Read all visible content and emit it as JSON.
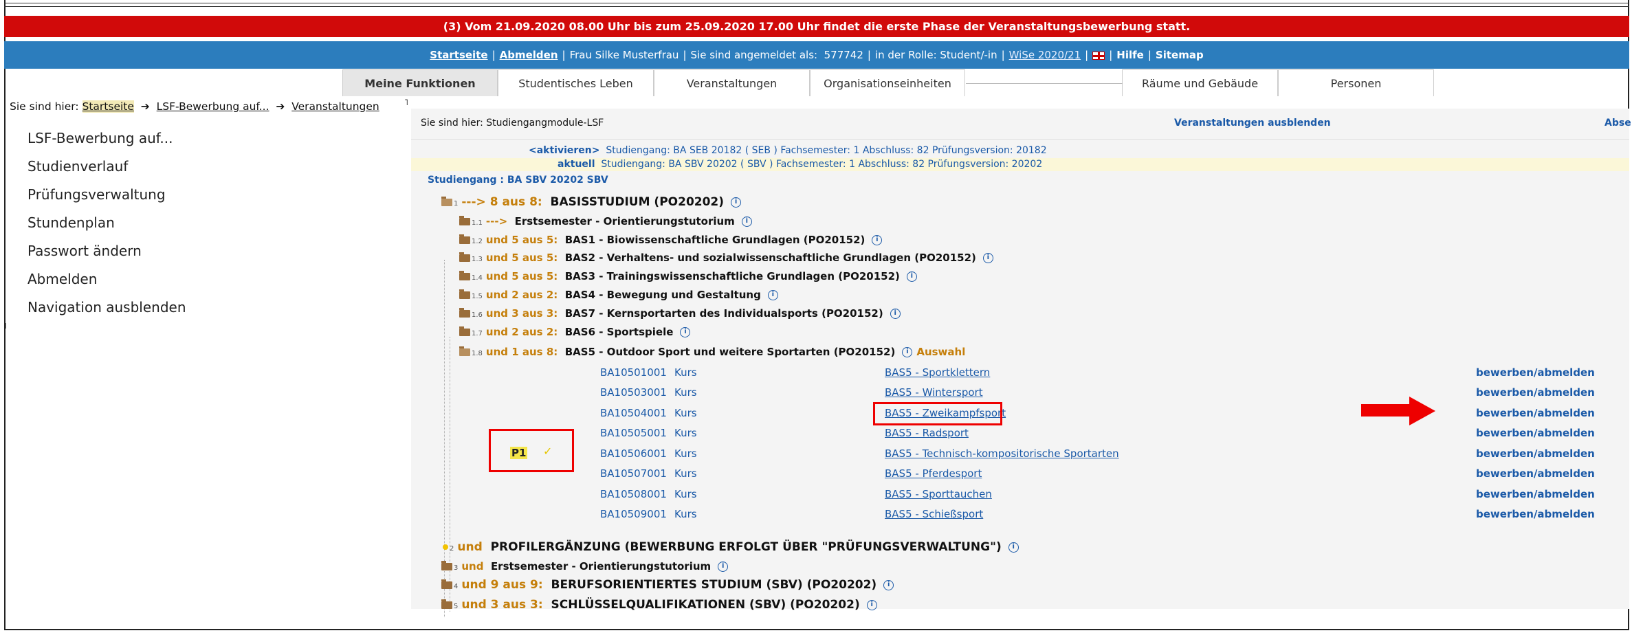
{
  "banner": "(3) Vom 21.09.2020 08.00 Uhr bis zum 25.09.2020 17.00 Uhr findet die erste Phase der Veranstaltungsbewerbung statt.",
  "toolbar": {
    "startseite": "Startseite",
    "abmelden": "Abmelden",
    "user": "Frau Silke Musterfrau",
    "logged_in_as": "Sie sind angemeldet als:",
    "user_id": "577742",
    "role": "in der Rolle: Student/-in",
    "semester": "WiSe 2020/21",
    "hilfe": "Hilfe",
    "sitemap": "Sitemap"
  },
  "tabs": [
    "Meine Funktionen",
    "Studentisches Leben",
    "Veranstaltungen",
    "Organisationseinheiten",
    "Räume und Gebäude",
    "Personen"
  ],
  "breadcrumb": {
    "prefix": "Sie sind hier:",
    "items": [
      "Startseite",
      "LSF-Bewerbung auf...",
      "Veranstaltungen"
    ]
  },
  "leftnav": [
    "LSF-Bewerbung auf...",
    "Studienverlauf",
    "Prüfungsverwaltung",
    "Stundenplan",
    "Passwort ändern",
    "Abmelden",
    "Navigation ausblenden"
  ],
  "main_header": {
    "location": "Sie sind hier:   Studiengangmodule-LSF",
    "hide": "Veranstaltungen ausblenden",
    "cut": "Abse"
  },
  "studiengang_rows": [
    {
      "label": "<aktivieren>",
      "text": "Studiengang:   BA SEB 20182    ( SEB )   Fachsemester: 1 Abschluss: 82   Prüfungsversion: 20182"
    },
    {
      "label": "aktuell",
      "text": "Studiengang:   BA SBV 20202    ( SBV )   Fachsemester: 1 Abschluss: 82   Prüfungsversion: 20202"
    }
  ],
  "studiengang_label": "Studiengang :  BA SBV 20202 SBV",
  "tree": [
    {
      "num": "1",
      "rule": "---> 8 aus 8:",
      "title": "BASISSTUDIUM (PO20202)"
    },
    {
      "num": "1.1",
      "rule": "--->",
      "title": "Erstsemester - Orientierungstutorium"
    },
    {
      "num": "1.2",
      "rule": "und 5 aus 5:",
      "title": "BAS1 - Biowissenschaftliche Grundlagen (PO20152)"
    },
    {
      "num": "1.3",
      "rule": "und 5 aus 5:",
      "title": "BAS2 - Verhaltens- und sozialwissenschaftliche Grundlagen (PO20152)"
    },
    {
      "num": "1.4",
      "rule": "und 5 aus 5:",
      "title": "BAS3 - Trainingswissenschaftliche Grundlagen (PO20152)"
    },
    {
      "num": "1.5",
      "rule": "und 2 aus 2:",
      "title": "BAS4 - Bewegung und Gestaltung"
    },
    {
      "num": "1.6",
      "rule": "und 3 aus 3:",
      "title": "BAS7 - Kernsportarten des Individualsports (PO20152)"
    },
    {
      "num": "1.7",
      "rule": "und 2 aus 2:",
      "title": "BAS6 - Sportspiele"
    },
    {
      "num": "1.8",
      "rule": "und 1 aus 8:",
      "title": "BAS5 - Outdoor Sport und weitere Sportarten (PO20152)",
      "extra": "Auswahl"
    },
    {
      "num": "2",
      "rule": "und",
      "title": "PROFILERGÄNZUNG (BEWERBUNG ERFOLGT ÜBER \"PRÜFUNGSVERWALTUNG\")"
    },
    {
      "num": "3",
      "rule": "und",
      "title": "Erstsemester - Orientierungstutorium"
    },
    {
      "num": "4",
      "rule": "und 9 aus 9:",
      "title": "BERUFSORIENTIERTES STUDIUM (SBV) (PO20202)"
    },
    {
      "num": "5",
      "rule": "und 3 aus 3:",
      "title": "SCHLÜSSELQUALIFIKATIONEN (SBV) (PO20202)"
    }
  ],
  "courses": [
    {
      "id": "BA10501001",
      "type": "Kurs",
      "title": "BAS5 - Sportklettern",
      "action": "bewerben/abmelden"
    },
    {
      "id": "BA10503001",
      "type": "Kurs",
      "title": "BAS5 - Wintersport",
      "action": "bewerben/abmelden"
    },
    {
      "id": "BA10504001",
      "type": "Kurs",
      "title": "BAS5 - Zweikampfsport",
      "action": "bewerben/abmelden"
    },
    {
      "id": "BA10505001",
      "type": "Kurs",
      "title": "BAS5 - Radsport",
      "action": "bewerben/abmelden"
    },
    {
      "id": "BA10506001",
      "type": "Kurs",
      "title": "BAS5 - Technisch-kompositorische Sportarten",
      "action": "bewerben/abmelden"
    },
    {
      "id": "BA10507001",
      "type": "Kurs",
      "title": "BAS5 - Pferdesport",
      "action": "bewerben/abmelden"
    },
    {
      "id": "BA10508001",
      "type": "Kurs",
      "title": "BAS5 - Sporttauchen",
      "action": "bewerben/abmelden"
    },
    {
      "id": "BA10509001",
      "type": "Kurs",
      "title": "BAS5 - Schießsport",
      "action": "bewerben/abmelden"
    }
  ],
  "priority": {
    "label": "P1",
    "check": "✓"
  },
  "colors": {
    "banner": "#d10a0a",
    "toolbar": "#2c7dbd",
    "link": "#1b5aa8",
    "rule": "#c57f0b",
    "highlight": "#e00"
  }
}
